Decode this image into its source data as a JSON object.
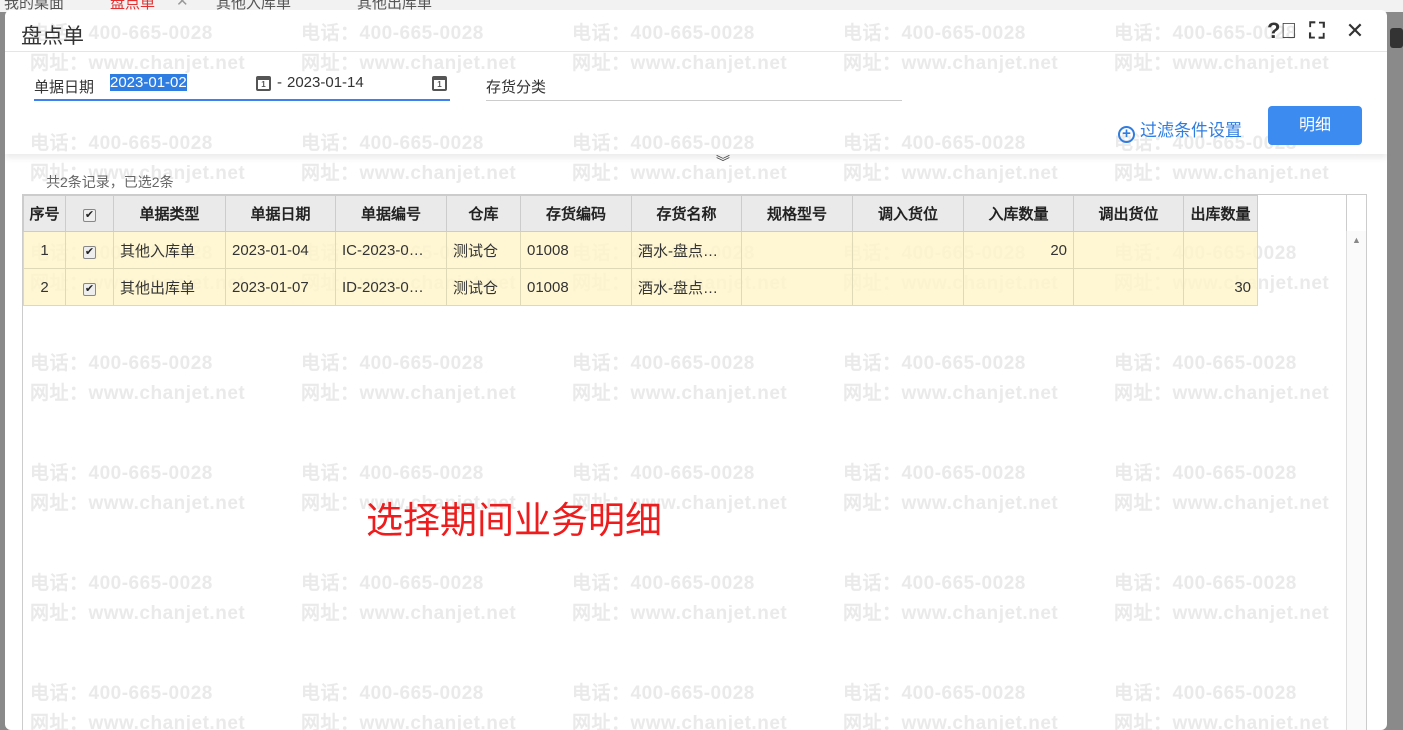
{
  "background_tabs": [
    "我的桌面",
    "盘点单",
    "其他入库单",
    "其他出库单"
  ],
  "watermark": {
    "phone": "电话：400-665-0028",
    "url": "网址：www.chanjet.net"
  },
  "dialog": {
    "title": "盘点单"
  },
  "filter": {
    "date_label": "单据日期",
    "date_from": "2023-01-02",
    "date_sep": "-",
    "date_to": "2023-01-14",
    "category_label": "存货分类",
    "category_value": "",
    "filter_settings": "过滤条件设置",
    "detail_button": "明细"
  },
  "summary": "共2条记录，已选2条",
  "table": {
    "columns": [
      "序号",
      "",
      "单据类型",
      "单据日期",
      "单据编号",
      "仓库",
      "存货编码",
      "存货名称",
      "规格型号",
      "调入货位",
      "入库数量",
      "调出货位",
      "出库数量"
    ],
    "rows": [
      [
        "1",
        true,
        "其他入库单",
        "2023-01-04",
        "IC-2023-0…",
        "测试仓",
        "01008",
        "酒水-盘点…",
        "",
        "",
        "20",
        "",
        ""
      ],
      [
        "2",
        true,
        "其他出库单",
        "2023-01-07",
        "ID-2023-0…",
        "测试仓",
        "01008",
        "酒水-盘点…",
        "",
        "",
        "",
        "",
        "30"
      ]
    ]
  },
  "annotation": "选择期间业务明细"
}
